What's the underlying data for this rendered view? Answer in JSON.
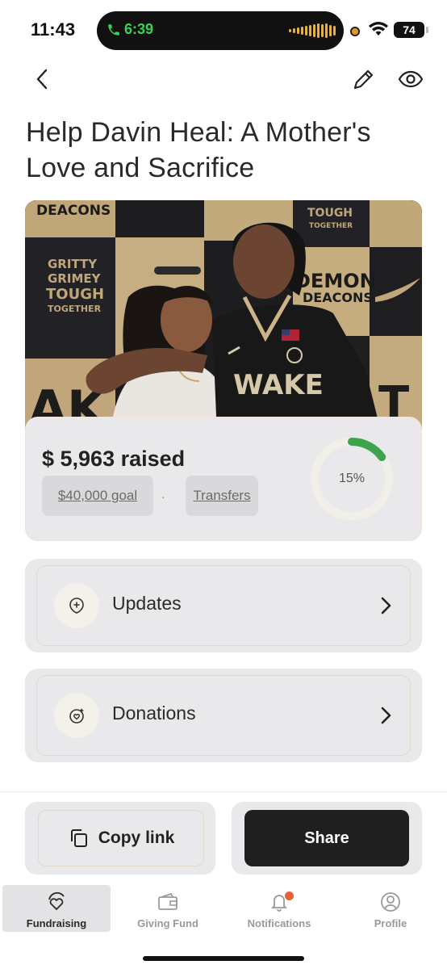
{
  "status_bar": {
    "time": "11:43",
    "call_time": "6:39",
    "battery": "74"
  },
  "nav": {
    "back_icon": "chevron-left-icon",
    "edit_icon": "pencil-icon",
    "view_icon": "eye-icon"
  },
  "page": {
    "title": "Help Davin Heal: A Mother's Love and Sacrifice"
  },
  "hero": {
    "banner_texts": [
      "DEACONS",
      "GRITTY GRIMEY TOUGH TOGETHER",
      "TOUGH TOGETHER",
      "DEMON DEACONS",
      "WAKE"
    ]
  },
  "fundraiser": {
    "raised": "$ 5,963 raised",
    "goal": "$40,000 goal",
    "separator": "·",
    "transfers": "Transfers",
    "progress_label": "15%",
    "progress_fraction": 0.15,
    "progress_color": "#3fa34d"
  },
  "cards": {
    "updates": "Updates",
    "donations": "Donations"
  },
  "actions": {
    "copy_link": "Copy link",
    "share": "Share"
  },
  "tabs": {
    "fundraising": "Fundraising",
    "giving_fund": "Giving Fund",
    "notifications": "Notifications",
    "profile": "Profile"
  }
}
